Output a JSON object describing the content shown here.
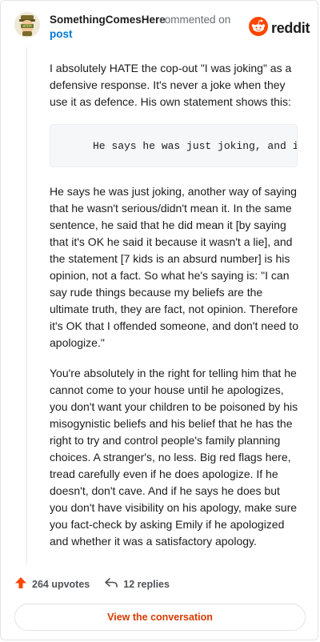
{
  "header": {
    "username": "SomethingComesHere",
    "commented_on": "commented on",
    "post_link": "post",
    "logo_text": "reddit",
    "avatar_badge": "HPFM"
  },
  "comment": {
    "p1": "I absolutely HATE the cop-out \"I was joking\" as a defensive response. It's never a joke when they use it as defence. His own statement shows this:",
    "code": "He says he was just joking, and it",
    "p2": "He says he was just joking, another way of saying that he wasn't serious/didn't mean it. In the same sentence, he said that he did mean it [by saying that it's OK he said it because it wasn't a lie], and the statement [7 kids is an absurd number] is his opinion, not a fact. So what he's saying is: \"I can say rude things because my beliefs are the ultimate truth, they are fact, not opinion. Therefore it's OK that I offended someone, and don't need to apologize.\"",
    "p3": "You're absolutely in the right for telling him that he cannot come to your house until he apologizes, you don't want your children to be poisoned by his misogynistic beliefs and his belief that he has the right to try and control people's family planning choices. A stranger's, no less. Big red flags here, tread carefully even if he does apologize. If he doesn't, don't cave. And if he says he does but you don't have visibility on his apology, make sure you fact-check by asking Emily if he apologized and whether it was a satisfactory apology."
  },
  "footer": {
    "upvotes": "264 upvotes",
    "replies": "12 replies",
    "cta": "View the conversation"
  },
  "colors": {
    "accent_link": "#0079d3",
    "reddit_orange": "#ff4500",
    "cta_text": "#d93a00"
  },
  "icons": [
    "avatar",
    "reddit-logo-icon",
    "upvote-arrow-icon",
    "reply-arrow-icon"
  ]
}
